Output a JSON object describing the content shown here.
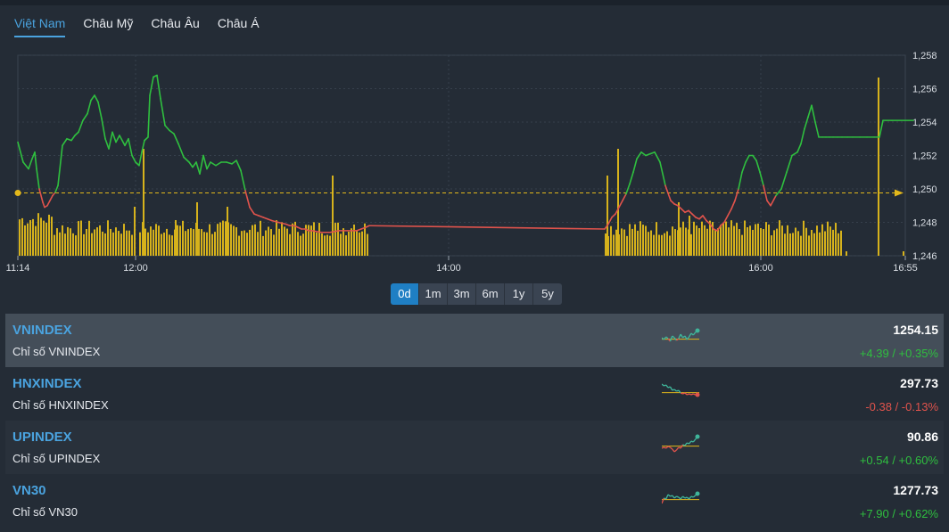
{
  "tabs": [
    {
      "label": "Việt Nam",
      "active": true
    },
    {
      "label": "Châu Mỹ",
      "active": false
    },
    {
      "label": "Châu Âu",
      "active": false
    },
    {
      "label": "Châu Á",
      "active": false
    }
  ],
  "colors": {
    "up": "#2fbf3f",
    "down": "#e0534c",
    "volume": "#d6b21c",
    "reference": "#e3b81b",
    "accent": "#4aa3df"
  },
  "chart_data": {
    "type": "line",
    "x_ticks": [
      "11:14",
      "12:00",
      "14:00",
      "16:00",
      "16:55"
    ],
    "y_ticks": [
      "1,246",
      "1,248",
      "1,250",
      "1,252",
      "1,254",
      "1,256",
      "1,258"
    ],
    "ylim": [
      1246,
      1258
    ],
    "reference_value": 1249.76,
    "series": [
      {
        "x": [
          0,
          6,
          12,
          16,
          19,
          21,
          24,
          28,
          30,
          33,
          36,
          39,
          42,
          45,
          50,
          55,
          60,
          64,
          68,
          73,
          78,
          82,
          86,
          90,
          94,
          98,
          102,
          106,
          110,
          114,
          120,
          124,
          128,
          132,
          136,
          139,
          142,
          146,
          148,
          152,
          156,
          160,
          165,
          170,
          175,
          180,
          186,
          192,
          196,
          200,
          204,
          208,
          212,
          216,
          222,
          228,
          234,
          240,
          245,
          250,
          255,
          260,
          265,
          270,
          275,
          280,
          285,
          292,
          300,
          305,
          310,
          314,
          318,
          322,
          326,
          330,
          340,
          350,
          360,
          370,
          380,
          385,
          390,
          394
        ],
        "y": [
          1252.8,
          1251.6,
          1251.2,
          1251.8,
          1252.2,
          1251.2,
          1250.0,
          1249.2,
          1248.9,
          1249.0,
          1249.3,
          1249.6,
          1249.8,
          1250.2,
          1252.6,
          1253.0,
          1252.9,
          1253.2,
          1253.4,
          1254.1,
          1254.5,
          1255.3,
          1255.6,
          1255.2,
          1254.2,
          1253.0,
          1252.4,
          1253.4,
          1252.8,
          1253.2,
          1252.6,
          1253.0,
          1252.0,
          1251.6,
          1251.4,
          1252.2,
          1252.9,
          1253.1,
          1255.6,
          1256.7,
          1256.8,
          1255.4,
          1253.8,
          1253.5,
          1253.3,
          1252.7,
          1251.9,
          1251.6,
          1251.3,
          1251.6,
          1250.9,
          1252.0,
          1251.2,
          1251.6,
          1251.4,
          1251.6,
          1251.6,
          1251.5,
          1251.7,
          1251.1,
          1249.9,
          1248.9,
          1248.5,
          1248.4,
          1248.3,
          1248.2,
          1248.1,
          1248.0,
          1247.9,
          1247.8,
          1247.8,
          1247.7,
          1247.6,
          1247.6,
          1247.5,
          1247.5,
          1247.4,
          1247.4,
          1247.5,
          1247.5,
          1247.5,
          1247.6,
          1247.7,
          1247.8
        ],
        "x2": [
          664,
          668,
          672,
          676,
          680,
          684,
          688,
          692,
          696,
          700,
          705,
          710,
          715,
          720,
          726,
          732,
          738,
          742,
          746,
          750,
          754,
          758,
          762,
          766,
          770,
          774,
          778,
          782,
          786,
          790,
          794,
          798,
          802,
          806,
          810,
          814,
          818,
          822,
          826,
          830,
          834,
          838,
          842,
          846,
          850,
          856,
          862,
          868,
          874,
          880,
          884,
          888,
          892,
          896,
          900,
          904,
          908,
          912,
          916,
          920,
          925,
          930,
          936,
          942,
          950,
          958,
          966,
          972,
          976,
          986,
          1010
        ],
        "y2": [
          1247.6,
          1247.9,
          1248.3,
          1248.5,
          1248.9,
          1249.3,
          1249.7,
          1250.3,
          1251.0,
          1251.8,
          1252.2,
          1252.0,
          1252.1,
          1252.2,
          1251.6,
          1250.2,
          1249.3,
          1249.1,
          1249.0,
          1248.8,
          1248.6,
          1248.7,
          1248.5,
          1248.3,
          1248.2,
          1248.4,
          1248.1,
          1247.9,
          1247.6,
          1247.5,
          1247.8,
          1248.0,
          1248.4,
          1248.8,
          1249.3,
          1250.0,
          1251.0,
          1251.6,
          1252.0,
          1252.0,
          1251.7,
          1251.0,
          1250.2,
          1249.3,
          1249.0,
          1249.6,
          1250.0,
          1251.0,
          1252.0,
          1252.2,
          1252.7,
          1253.6,
          1254.3,
          1255.0,
          1254.0,
          1253.1,
          1253.1,
          1253.1,
          1253.1,
          1253.1,
          1253.1,
          1253.1,
          1253.1,
          1253.1,
          1253.1,
          1253.1,
          1253.1,
          1253.1,
          1254.1,
          1254.1,
          1254.1
        ]
      }
    ]
  },
  "periods": [
    {
      "label": "0d",
      "active": true
    },
    {
      "label": "1m",
      "active": false
    },
    {
      "label": "3m",
      "active": false
    },
    {
      "label": "6m",
      "active": false
    },
    {
      "label": "1y",
      "active": false
    },
    {
      "label": "5y",
      "active": false
    }
  ],
  "indices": [
    {
      "symbol": "VNINDEX",
      "name": "Chỉ số VNINDEX",
      "value": "1254.15",
      "change": "+4.39 / +0.35%",
      "direction": "up",
      "spark": [
        0.5,
        0.4,
        0.55,
        0.45,
        0.3,
        0.6,
        0.5,
        0.35,
        0.45,
        0.7,
        0.5,
        0.6,
        0.4,
        0.55,
        0.75,
        0.65,
        0.8,
        0.9
      ]
    },
    {
      "symbol": "HNXINDEX",
      "name": "Chỉ số HNXINDEX",
      "value": "297.73",
      "change": "-0.38 / -0.13%",
      "direction": "down",
      "spark": [
        0.9,
        0.8,
        0.85,
        0.7,
        0.75,
        0.55,
        0.6,
        0.5,
        0.55,
        0.4,
        0.35,
        0.4,
        0.3,
        0.35,
        0.3,
        0.35,
        0.3,
        0.3
      ]
    },
    {
      "symbol": "UPINDEX",
      "name": "Chỉ số UPINDEX",
      "value": "90.86",
      "change": "+0.54 / +0.60%",
      "direction": "up",
      "spark": [
        0.3,
        0.35,
        0.3,
        0.4,
        0.35,
        0.25,
        0.1,
        0.2,
        0.35,
        0.3,
        0.5,
        0.45,
        0.6,
        0.55,
        0.7,
        0.65,
        0.8,
        0.95
      ]
    },
    {
      "symbol": "VN30",
      "name": "Chỉ số VN30",
      "value": "1277.73",
      "change": "+7.90 / +0.62%",
      "direction": "up",
      "spark": [
        0.2,
        0.5,
        0.45,
        0.7,
        0.6,
        0.65,
        0.5,
        0.6,
        0.55,
        0.45,
        0.6,
        0.5,
        0.55,
        0.45,
        0.6,
        0.55,
        0.65,
        0.75
      ]
    }
  ]
}
